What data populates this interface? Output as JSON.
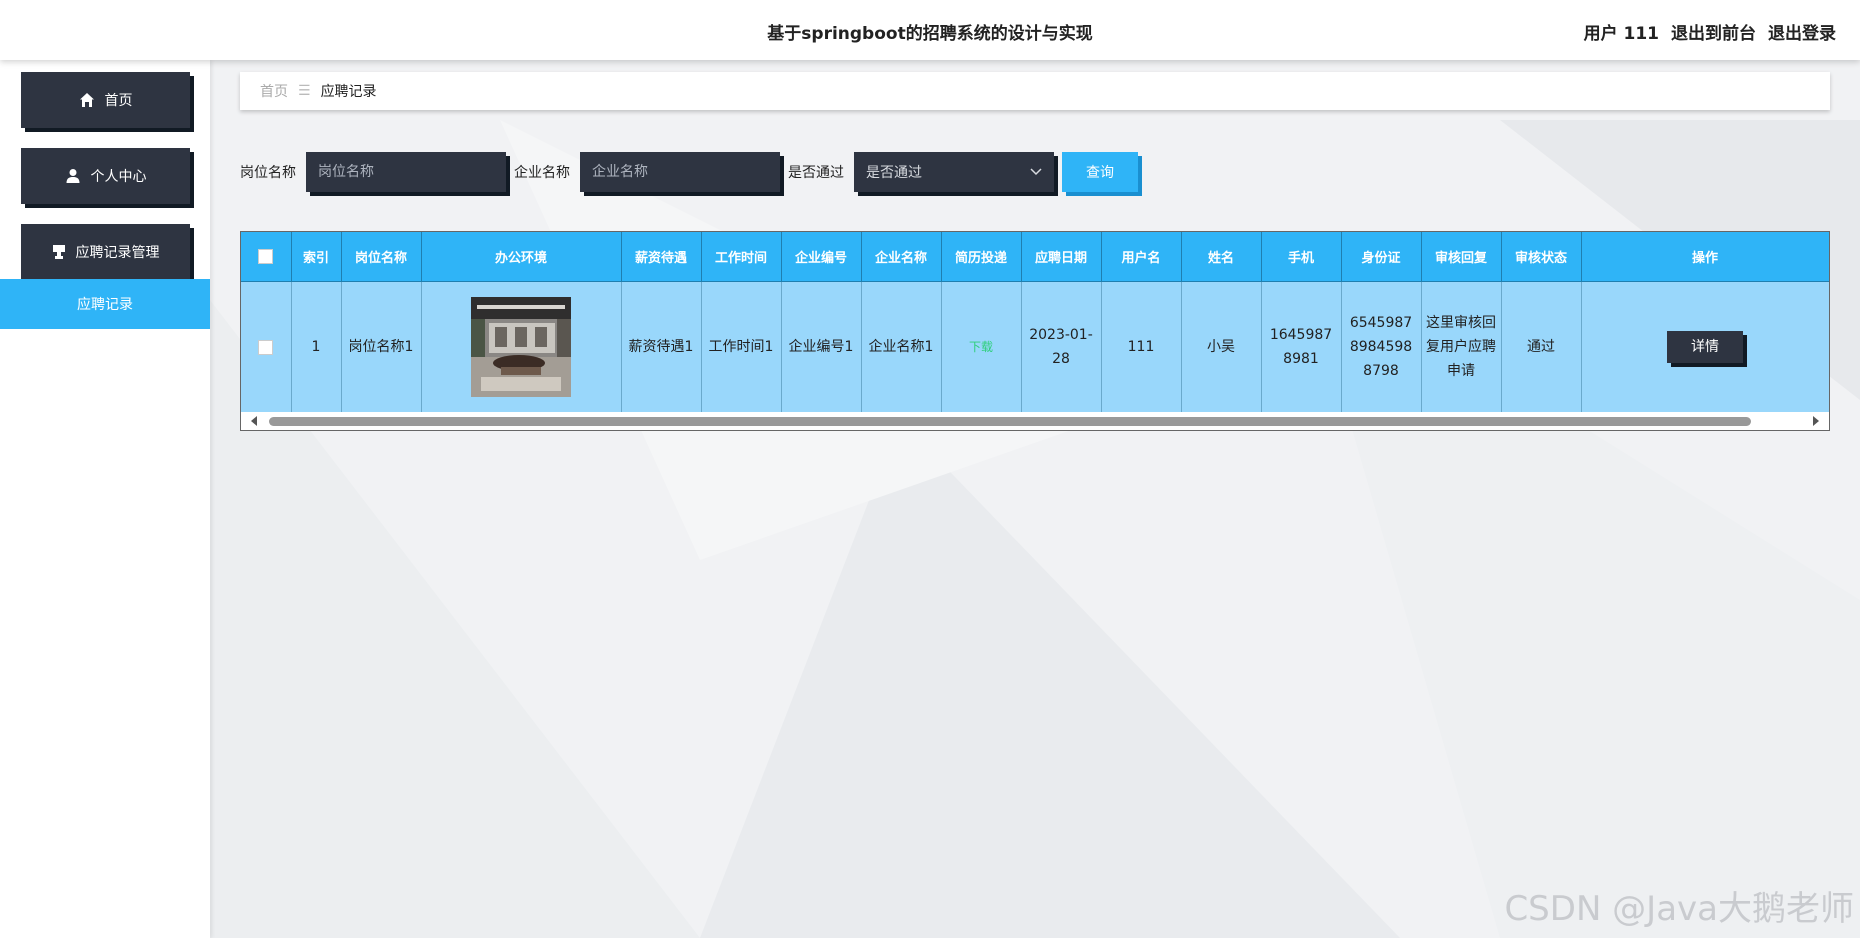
{
  "header": {
    "title": "基于springboot的招聘系统的设计与实现",
    "user_label": "用户 111",
    "back_to_front": "退出到前台",
    "logout": "退出登录"
  },
  "sidebar": {
    "items": [
      {
        "label": "首页",
        "icon": "home-icon"
      },
      {
        "label": "个人中心",
        "icon": "user-icon"
      },
      {
        "label": "应聘记录管理",
        "icon": "stamp-icon"
      }
    ],
    "submenu": {
      "label": "应聘记录"
    }
  },
  "breadcrumb": {
    "home": "首页",
    "separator": "☰",
    "current": "应聘记录"
  },
  "search": {
    "job_label": "岗位名称",
    "job_placeholder": "岗位名称",
    "company_label": "企业名称",
    "company_placeholder": "企业名称",
    "pass_label": "是否通过",
    "pass_value": "是否通过",
    "query_button": "查询"
  },
  "table": {
    "headers": [
      "索引",
      "岗位名称",
      "办公环境",
      "薪资待遇",
      "工作时间",
      "企业编号",
      "企业名称",
      "简历投递",
      "应聘日期",
      "用户名",
      "姓名",
      "手机",
      "身份证",
      "审核回复",
      "审核状态",
      "操作"
    ],
    "rows": [
      {
        "index": "1",
        "job_name": "岗位名称1",
        "salary": "薪资待遇1",
        "work_time": "工作时间1",
        "company_no": "企业编号1",
        "company_name": "企业名称1",
        "resume": "下载",
        "apply_date": "2023-01-28",
        "username": "111",
        "name": "小吴",
        "phone": "16459878981",
        "id_card": "654598789845988798",
        "review_reply": "这里审核回复用户应聘申请",
        "review_status": "通过",
        "action": "详情"
      }
    ]
  },
  "watermark": "CSDN @Java大鹅老师",
  "colors": {
    "accent": "#2fb4f7",
    "dark": "#2e3441",
    "row_bg": "#99d7fb",
    "download": "#2ecf7a"
  }
}
